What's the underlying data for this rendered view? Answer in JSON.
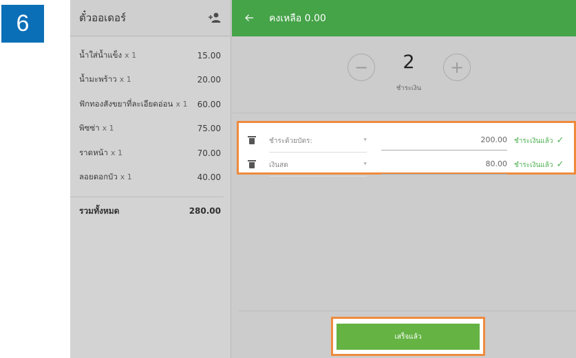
{
  "step_badge": "6",
  "order": {
    "title": "ตั๋วออเดอร์",
    "add_icon": "add-person-icon",
    "items": [
      {
        "name": "น้ำใส่น้ำแข็ง",
        "qty": "x 1",
        "price": "15.00"
      },
      {
        "name": "น้ำมะพร้าว",
        "qty": "x 1",
        "price": "20.00"
      },
      {
        "name": "ฟักทองสังขยาที่ละเอียดอ่อน",
        "qty": "x 1",
        "price": "60.00"
      },
      {
        "name": "พิซซ่า",
        "qty": "x 1",
        "price": "75.00"
      },
      {
        "name": "ราดหน้า",
        "qty": "x 1",
        "price": "70.00"
      },
      {
        "name": "ลอยดอกบัว",
        "qty": "x 1",
        "price": "40.00"
      }
    ],
    "total_label": "รวมทั้งหมด",
    "total_value": "280.00"
  },
  "payment": {
    "back_icon": "arrow-left-icon",
    "remaining_label": "คงเหลือ 0.00",
    "split": {
      "minus": "−",
      "plus": "+",
      "count": "2",
      "label": "ชำระเงิน"
    },
    "rows": [
      {
        "method": "ชำระด้วยบัตร:",
        "amount": "200.00",
        "status": "ชำระเงินแล้ว",
        "check": "✓"
      },
      {
        "method": "เงินสด",
        "amount": "80.00",
        "status": "ชำระเงินแล้ว",
        "check": "✓"
      }
    ],
    "done_label": "เสร็จแล้ว"
  },
  "colors": {
    "header_green": "#45a348",
    "button_green": "#64b343",
    "highlight_orange": "#ef8a3c",
    "badge_blue": "#0b6fb8"
  }
}
